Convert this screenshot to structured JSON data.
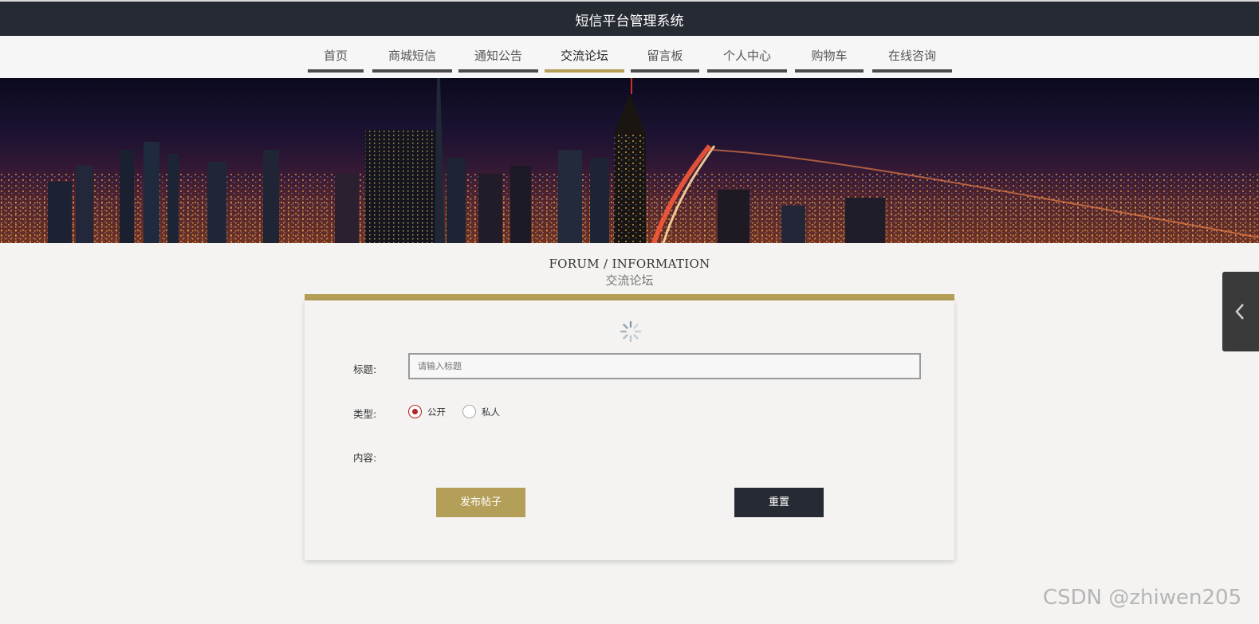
{
  "header": {
    "title": "短信平台管理系统"
  },
  "nav": {
    "items": [
      {
        "label": "首页",
        "active": false
      },
      {
        "label": "商城短信",
        "active": false
      },
      {
        "label": "通知公告",
        "active": false
      },
      {
        "label": "交流论坛",
        "active": true
      },
      {
        "label": "留言板",
        "active": false
      },
      {
        "label": "个人中心",
        "active": false
      },
      {
        "label": "购物车",
        "active": false
      },
      {
        "label": "在线咨询",
        "active": false
      }
    ]
  },
  "banner": {
    "image": "night-city-skyline"
  },
  "section": {
    "title_en": "FORUM / INFORMATION",
    "title_cn": "交流论坛"
  },
  "form": {
    "title_label": "标题:",
    "title_placeholder": "请输入标题",
    "type_label": "类型:",
    "type_options": [
      {
        "label": "公开",
        "checked": true
      },
      {
        "label": "私人",
        "checked": false
      }
    ],
    "content_label": "内容:",
    "submit_label": "发布帖子",
    "reset_label": "重置"
  },
  "side_tab": {
    "icon": "chevron-left-icon"
  },
  "watermark": "CSDN @zhiwen205",
  "colors": {
    "accent": "#b49f58",
    "dark": "#262a33",
    "radio": "#b42222"
  }
}
